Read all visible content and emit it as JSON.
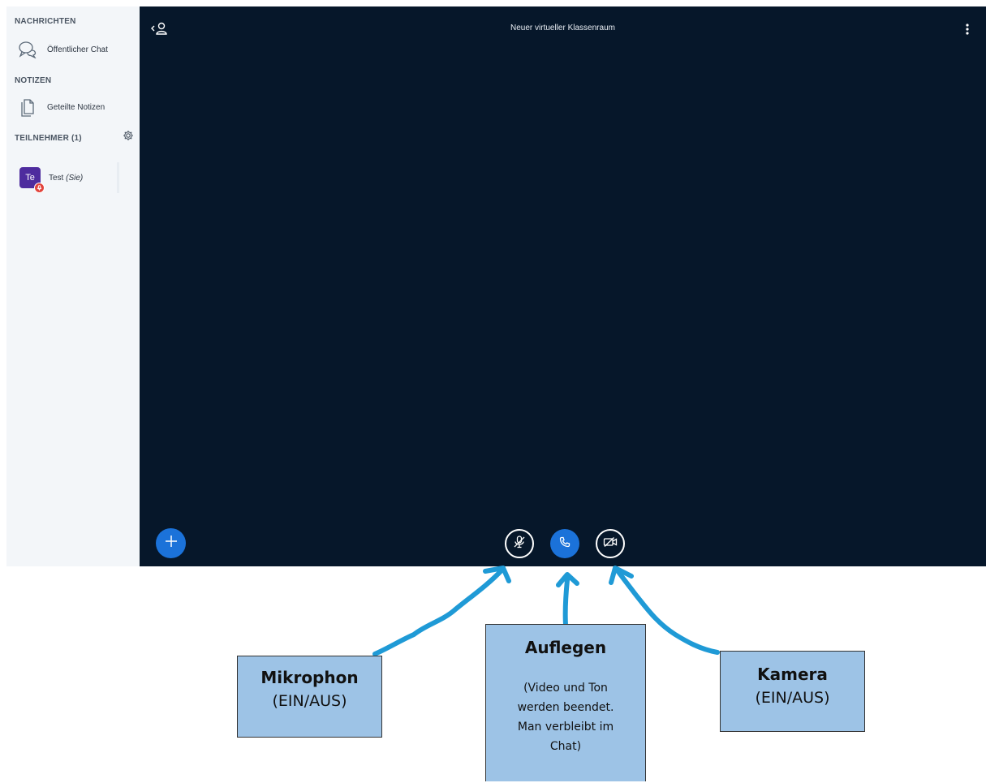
{
  "sidebar": {
    "messages_title": "NACHRICHTEN",
    "public_chat": "Öffentlicher Chat",
    "notes_title": "NOTIZEN",
    "shared_notes": "Geteilte Notizen",
    "participants_title": "TEILNEHMER (1)",
    "user": {
      "initials": "Te",
      "name": "Test",
      "self_label": "(Sie)"
    }
  },
  "main": {
    "room_title": "Neuer virtueller Klassenraum"
  },
  "callouts": {
    "mic": {
      "title": "Mikrophon",
      "sub": "(EIN/AUS)"
    },
    "hangup": {
      "title": "Auflegen",
      "lines": [
        "(Video und Ton",
        "werden beendet.",
        "Man verbleibt im",
        "Chat)"
      ]
    },
    "camera": {
      "title": "Kamera",
      "sub": "(EIN/AUS)"
    }
  },
  "colors": {
    "main_bg": "#06172a",
    "sidebar_bg": "#f3f6f9",
    "accent": "#1b72d9",
    "callout_bg": "#9dc3e6",
    "arrow": "#1f9ad6",
    "avatar": "#4e2c9e",
    "mute": "#e2433b"
  },
  "icons": [
    "chat-icon",
    "notes-icon",
    "gear-icon",
    "back-user-icon",
    "kebab-icon",
    "plus-icon",
    "mic-off-icon",
    "phone-icon",
    "camera-off-icon"
  ]
}
